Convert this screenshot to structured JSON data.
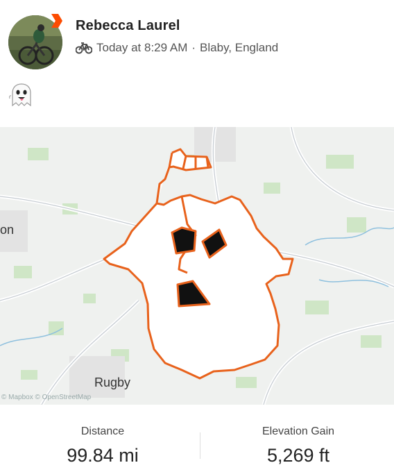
{
  "activity": {
    "athlete_name": "Rebecca  Laurel",
    "time": "Today at 8:29 AM",
    "separator": "·",
    "location": "Blaby, England",
    "sport_icon": "bike-icon",
    "description_icon": "ghost-emoji-icon"
  },
  "map": {
    "labels": {
      "left_town": "on",
      "rugby": "Rugby"
    },
    "attribution": "© Mapbox © OpenStreetMap",
    "route_color": "#e8621c"
  },
  "stats": [
    {
      "label": "Distance",
      "value": "99.84 mi"
    },
    {
      "label": "Elevation Gain",
      "value": "5,269 ft"
    }
  ],
  "colors": {
    "accent": "#fc4c02",
    "route": "#e8621c"
  }
}
